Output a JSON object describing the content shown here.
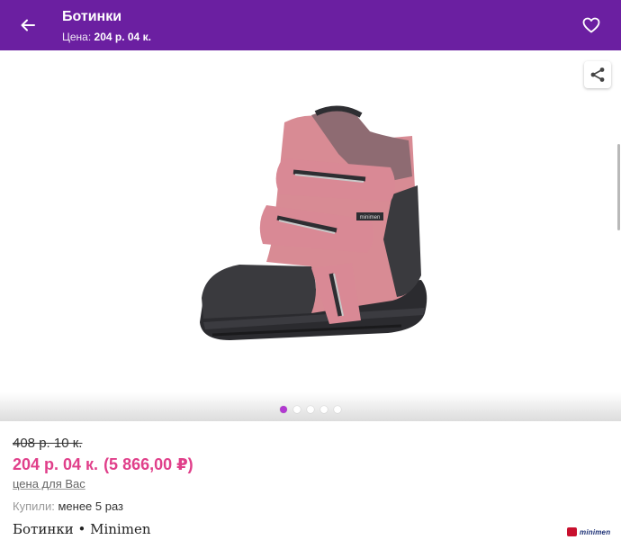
{
  "header": {
    "title": "Ботинки",
    "price_label": "Цена:",
    "price_value": "204 р. 04 к."
  },
  "gallery": {
    "image_alt": "Ботинки Minimen",
    "boot_label": "minimen",
    "dots_count": 5,
    "active_index": 0
  },
  "pricing": {
    "old_price": "408 р. 10 к.",
    "current_price": "204 р. 04 к.",
    "rub_price": "(5 866,00 ₽)",
    "note": "цена для Вас"
  },
  "bought": {
    "label": "Купили:",
    "value": "менее 5 раз"
  },
  "product": {
    "line": "Ботинки • Minimen",
    "brand_logo_text": "minimen"
  },
  "colors": {
    "header_bg": "#6b1fa1",
    "price": "#e03f8a",
    "dot_active": "#b23ad1"
  },
  "icons": {
    "back": "arrow-left-icon",
    "favorite": "heart-icon",
    "share": "share-icon"
  }
}
